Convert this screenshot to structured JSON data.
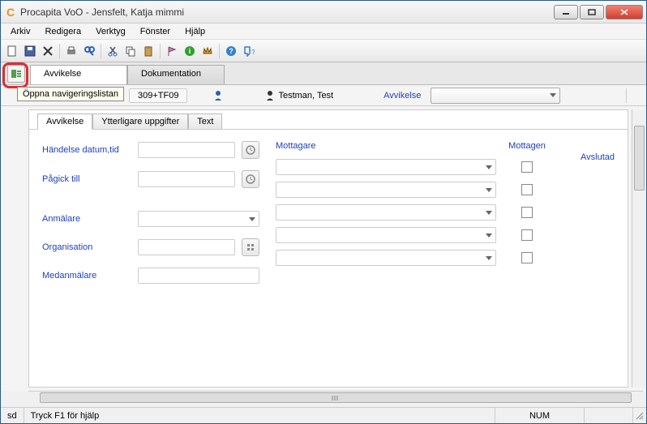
{
  "window": {
    "title": "Procapita VoO - Jensfelt, Katja mimmi"
  },
  "menu": {
    "arkiv": "Arkiv",
    "redigera": "Redigera",
    "verktyg": "Verktyg",
    "fonster": "Fönster",
    "hjalp": "Hjälp"
  },
  "mainTabs": {
    "avvikelse": "Avvikelse",
    "dokumentation": "Dokumentation"
  },
  "tooltip": "Öppna navigeringslistan",
  "context": {
    "idchip": "309+TF09",
    "person": "Testman, Test",
    "section": "Avvikelse"
  },
  "subTabs": {
    "avvikelse": "Avvikelse",
    "ytterligare": "Ytterligare uppgifter",
    "text": "Text"
  },
  "form": {
    "handelse": "Händelse datum,tid",
    "pagick": "Pågick till",
    "anmalare": "Anmälare",
    "organisation": "Organisation",
    "medanmalare": "Medanmälare",
    "mottagare": "Mottagare",
    "mottagen": "Mottagen",
    "avslutad": "Avslutad"
  },
  "status": {
    "left": "sd",
    "help": "Tryck F1 för hjälp",
    "num": "NUM"
  }
}
